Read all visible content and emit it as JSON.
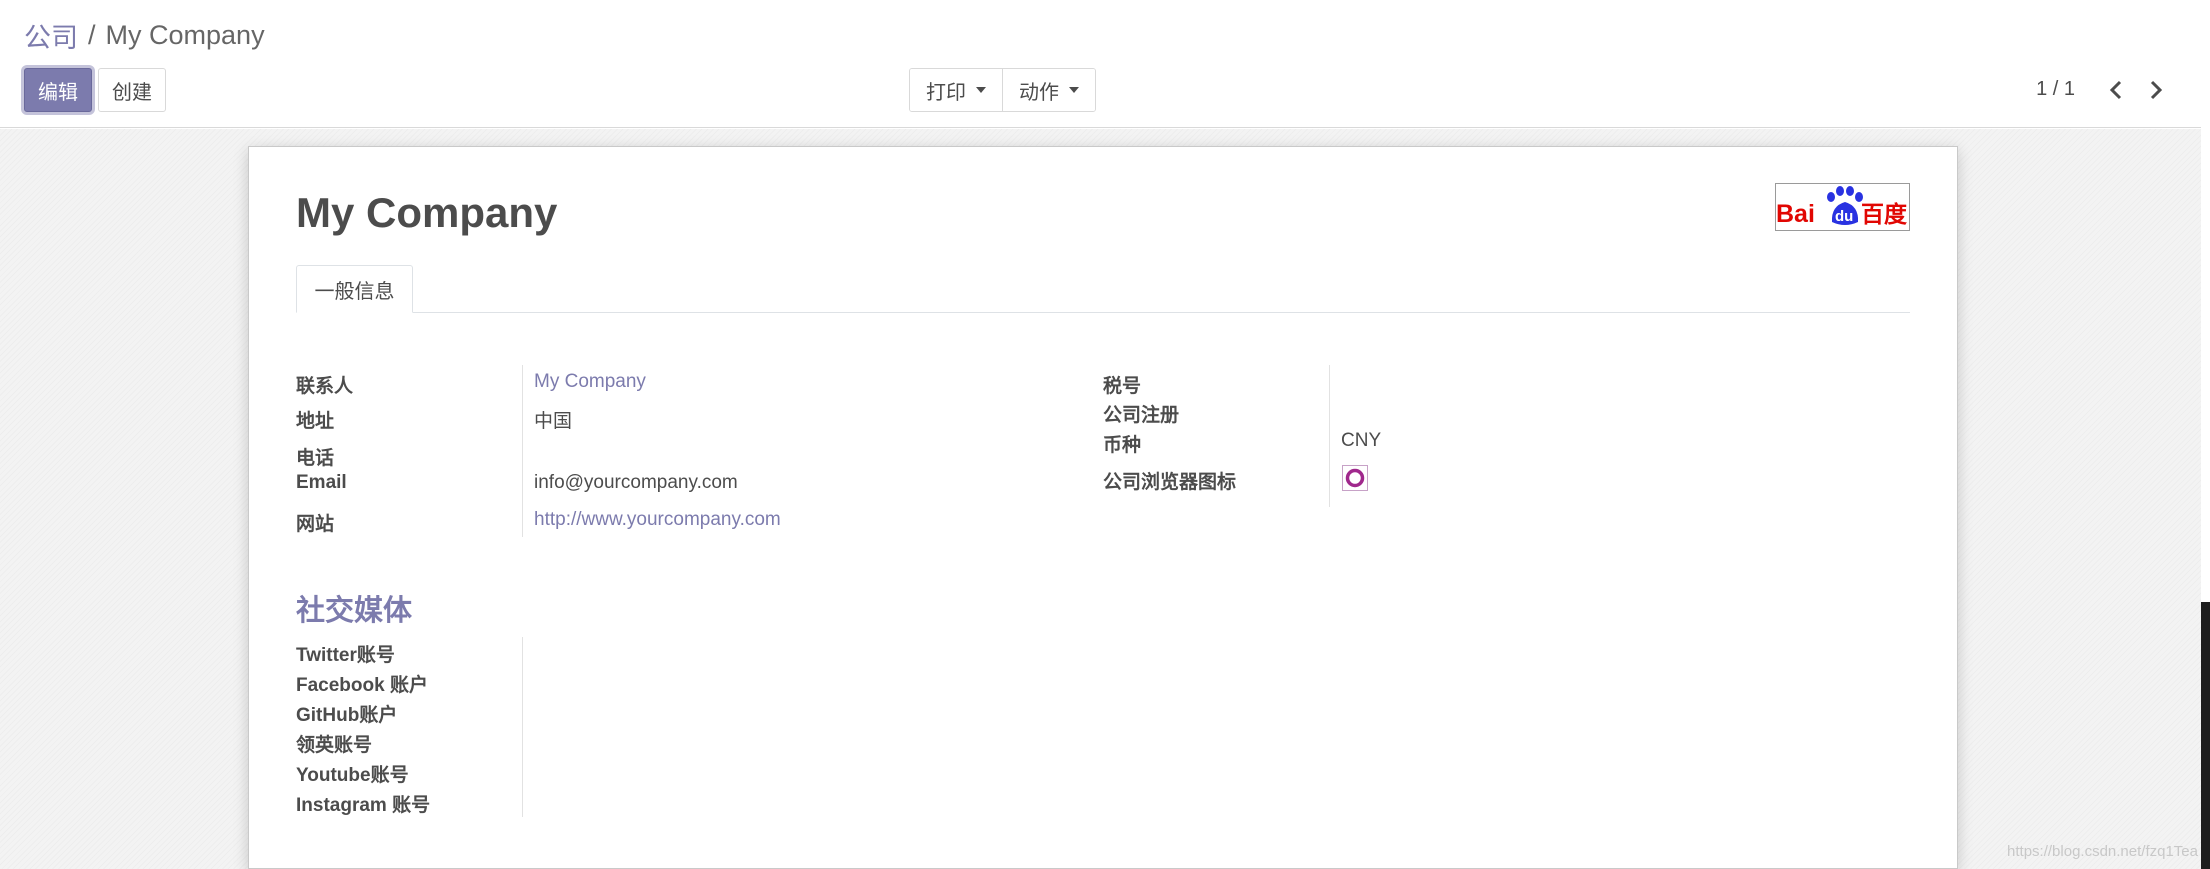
{
  "breadcrumb": {
    "parent": "公司",
    "separator": "/",
    "current": "My Company"
  },
  "toolbar": {
    "edit_label": "编辑",
    "create_label": "创建",
    "print_label": "打印",
    "action_label": "动作"
  },
  "pager": {
    "value": "1 / 1"
  },
  "record": {
    "title": "My Company",
    "logo": {
      "text_left": "Bai",
      "text_mid": "du",
      "text_right": "百度"
    },
    "tab_general": "一般信息",
    "left_fields": {
      "contact_label": "联系人",
      "contact_value": "My Company",
      "address_label": "地址",
      "address_value": "中国",
      "phone_label": "电话",
      "phone_value": "",
      "email_label": "Email",
      "email_value": "info@yourcompany.com",
      "website_label": "网站",
      "website_value": "http://www.yourcompany.com"
    },
    "right_fields": {
      "vat_label": "税号",
      "vat_value": "",
      "registry_label": "公司注册",
      "registry_value": "",
      "currency_label": "币种",
      "currency_value": "CNY",
      "favicon_label": "公司浏览器图标"
    },
    "social": {
      "title": "社交媒体",
      "twitter_label": "Twitter账号",
      "facebook_label": "Facebook 账户",
      "github_label": "GitHub账户",
      "linkedin_label": "领英账号",
      "youtube_label": "Youtube账号",
      "instagram_label": "Instagram 账号"
    }
  },
  "watermark": "https://blog.csdn.net/fzq1Tea",
  "colors": {
    "accent": "#7c7bad",
    "text": "#4c4c4c",
    "baidu_red": "#e10602",
    "baidu_blue": "#2932e1",
    "favicon_ring": "#a0288c"
  },
  "icons": {
    "prev": "chevron-left-icon",
    "next": "chevron-right-icon",
    "dropdown": "caret-down-icon",
    "favicon": "ring-icon"
  }
}
